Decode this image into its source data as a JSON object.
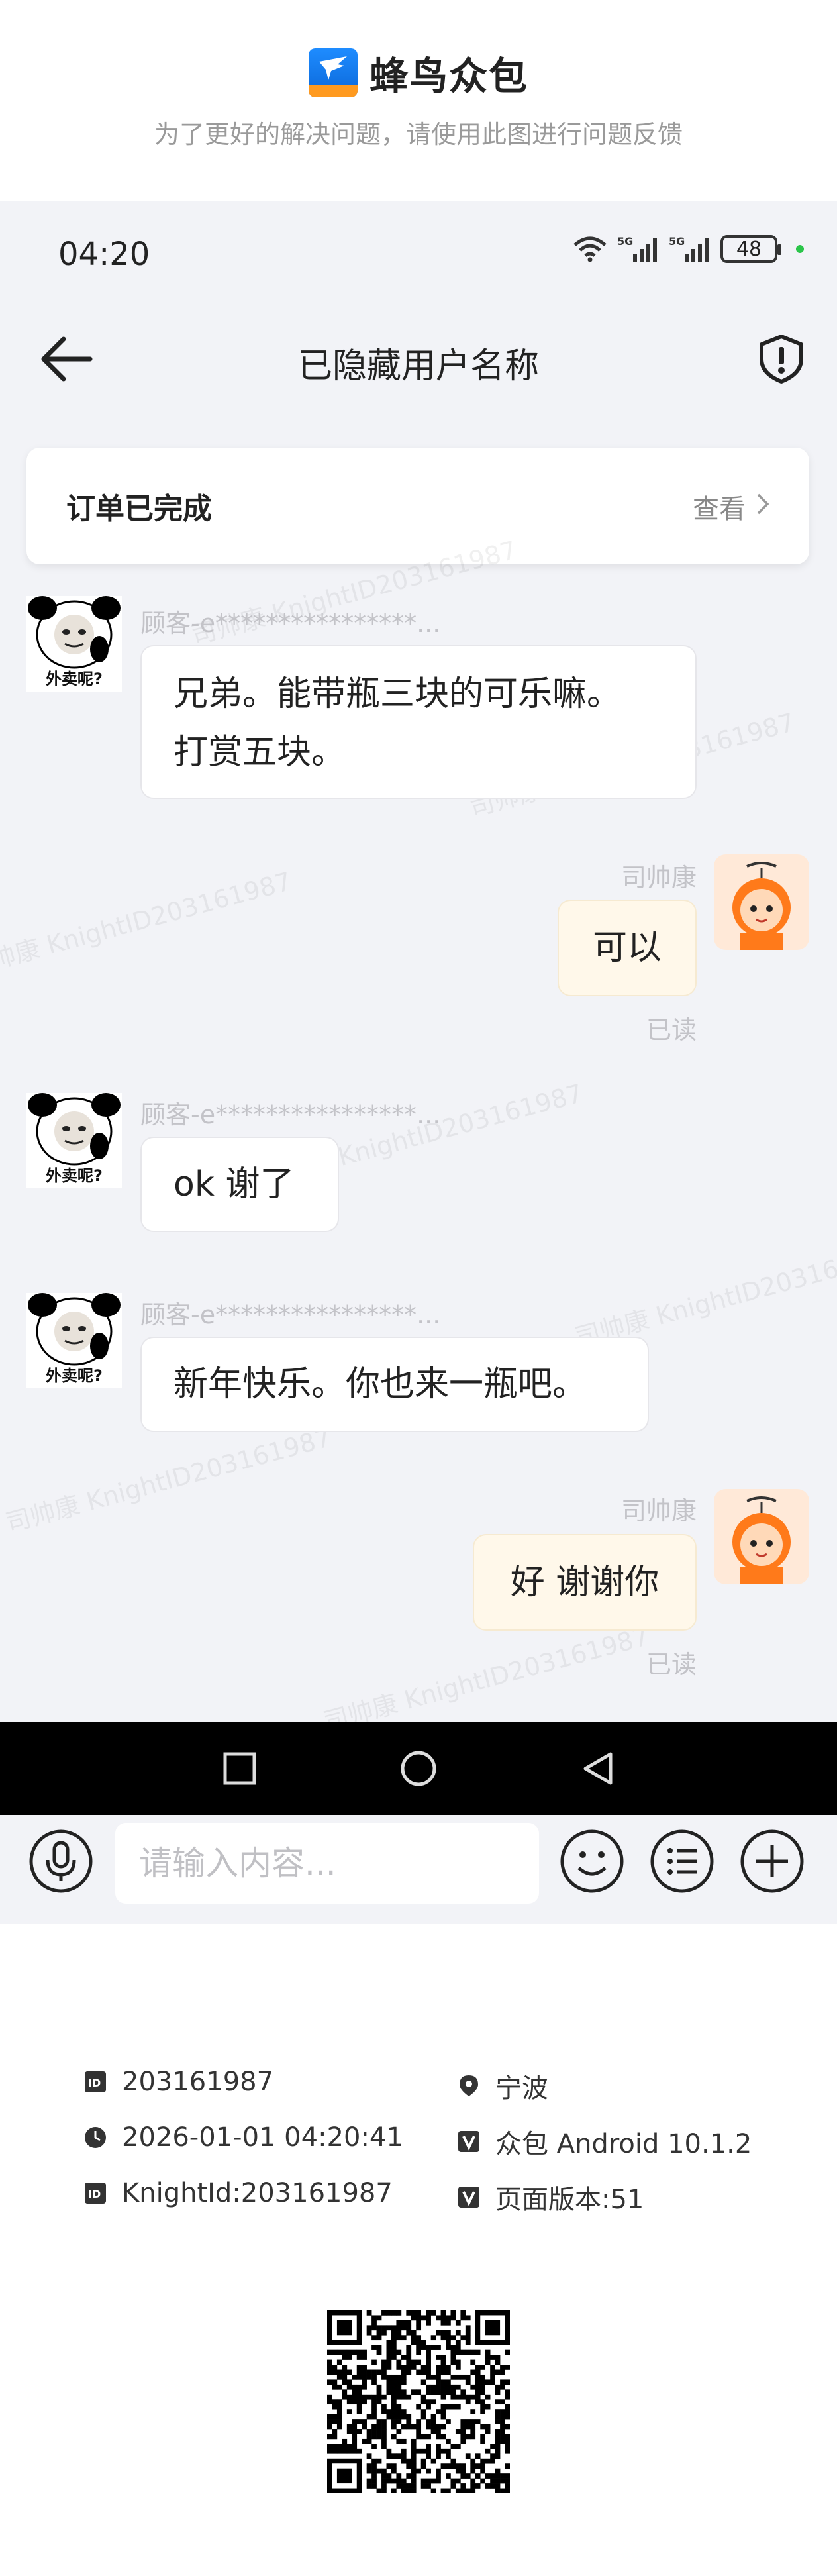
{
  "banner": {
    "app_name": "蜂鸟众包",
    "subtitle": "为了更好的解决问题，请使用此图进行问题反馈",
    "logo_icon": "hummingbird-logo-icon"
  },
  "status_bar": {
    "time": "04:20",
    "network_1": "5G",
    "network_2": "5G",
    "battery": "48"
  },
  "nav": {
    "title": "已隐藏用户名称",
    "back_icon": "back-arrow-icon",
    "report_icon": "shield-alert-icon"
  },
  "order": {
    "status": "订单已完成",
    "view_label": "查看"
  },
  "messages": [
    {
      "side": "left",
      "sender": "顾客-e****************...",
      "avatar_caption": "外卖呢?",
      "lines": [
        "兄弟。能带瓶三块的可乐嘛。",
        "打赏五块。"
      ]
    },
    {
      "side": "right",
      "sender": "司帅康",
      "text": "可以",
      "read": "已读"
    },
    {
      "side": "left",
      "sender": "顾客-e****************...",
      "avatar_caption": "外卖呢?",
      "text": "ok  谢了"
    },
    {
      "side": "left",
      "sender": "顾客-e****************...",
      "avatar_caption": "外卖呢?",
      "text": "新年快乐。你也来一瓶吧。"
    },
    {
      "side": "right",
      "sender": "司帅康",
      "text": "好 谢谢你",
      "read": "已读"
    }
  ],
  "input_bar": {
    "placeholder": "请输入内容..."
  },
  "footer": {
    "id": "203161987",
    "location": "宁波",
    "datetime": "2026-01-01 04:20:41",
    "app_version": "众包 Android 10.1.2",
    "knight_id": "KnightId:203161987",
    "page_version": "页面版本:51"
  },
  "colors": {
    "chat_bg": "#f2f3f7",
    "my_bubble": "#fff8ea",
    "brand_blue": "#1e8cff",
    "brand_orange": "#ff9a1f"
  }
}
